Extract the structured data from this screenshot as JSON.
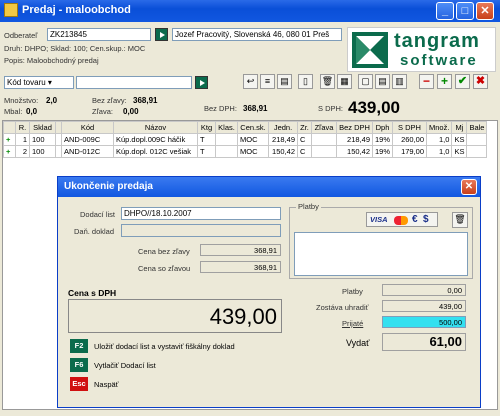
{
  "window": {
    "title": "Predaj - maloobchod"
  },
  "header": {
    "odberatel_label": "Odberateľ",
    "odberatel_code": "ZK213845",
    "odberatel_name": "Jozef Pracovitý, Slovenská 46, 080 01 Preš",
    "info1": "Druh: DHPO; Sklad: 100; Cen.skup.: MOC",
    "info2": "Popis: Maloobchodný predaj",
    "search_select": "Kód tovaru",
    "logo_line1": "tangram",
    "logo_line2": "software"
  },
  "totals": {
    "mnozstvo_label": "Množstvo:",
    "mnozstvo": "2,0",
    "mbal_label": "Mbal:",
    "mbal": "0,0",
    "bez_zlavy_label": "Bez zľavy:",
    "bez_zlavy": "368,91",
    "zlava_label": "Zľava:",
    "zlava": "0,00",
    "bez_dph_label": "Bez DPH:",
    "bez_dph": "368,91",
    "s_dph_label": "S DPH:",
    "s_dph": "439,00"
  },
  "table": {
    "headers": [
      "",
      "R.",
      "Sklad",
      "",
      "Kód",
      "Názov",
      "Ktg",
      "Klas.",
      "Cen.sk.",
      "Jedn.",
      "Zr.",
      "Zľava",
      "Bez DPH",
      "Dph",
      "S DPH",
      "Množ.",
      "Mj",
      "Bale"
    ],
    "rows": [
      [
        "+",
        "1",
        "100",
        "",
        "AND-009C",
        "Kúp.dopl.009C háčik",
        "T",
        "",
        "MOC",
        "218,49",
        "C",
        "",
        "218,49",
        "19%",
        "260,00",
        "1,0",
        "KS",
        ""
      ],
      [
        "+",
        "2",
        "100",
        "",
        "AND-012C",
        "Kúp.dopl. 012C vešiak",
        "T",
        "",
        "MOC",
        "150,42",
        "C",
        "",
        "150,42",
        "19%",
        "179,00",
        "1,0",
        "KS",
        ""
      ]
    ]
  },
  "dialog": {
    "title": "Ukončenie predaja",
    "dodaci_list_label": "Dodací list",
    "dodaci_list": "DHPO//18.10.2007",
    "dan_doklad_label": "Daň. doklad",
    "dan_doklad": "",
    "cena_bez_zlavy_label": "Cena bez zľavy",
    "cena_bez_zlavy": "368,91",
    "cena_so_zlavou_label": "Cena so zľavou",
    "cena_so_zlavou": "368,91",
    "cena_s_dph_label": "Cena s DPH",
    "cena_s_dph": "439,00",
    "platby_group": "Platby",
    "card_visa": "VISA",
    "card_euro": "€",
    "card_dollar": "$",
    "platby_label": "Platby",
    "platby": "0,00",
    "zostava_label": "Zostáva uhradiť",
    "zostava": "439,00",
    "prijate_label": "Prijaté",
    "prijate": "500,00",
    "vydat_label": "Vydať",
    "vydat": "61,00",
    "f2_key": "F2",
    "f2_text": "Uložiť dodací list a vystaviť fiškálny doklad",
    "f6_key": "F6",
    "f6_text": "Vytlačiť Dodací list",
    "esc_key": "Esc",
    "esc_text": "Naspäť"
  },
  "colors": {
    "title_bar": "#0a4fd8",
    "accent_green": "#0b6b4c",
    "prijate_bg": "#33e0f0",
    "esc": "#d01010"
  }
}
